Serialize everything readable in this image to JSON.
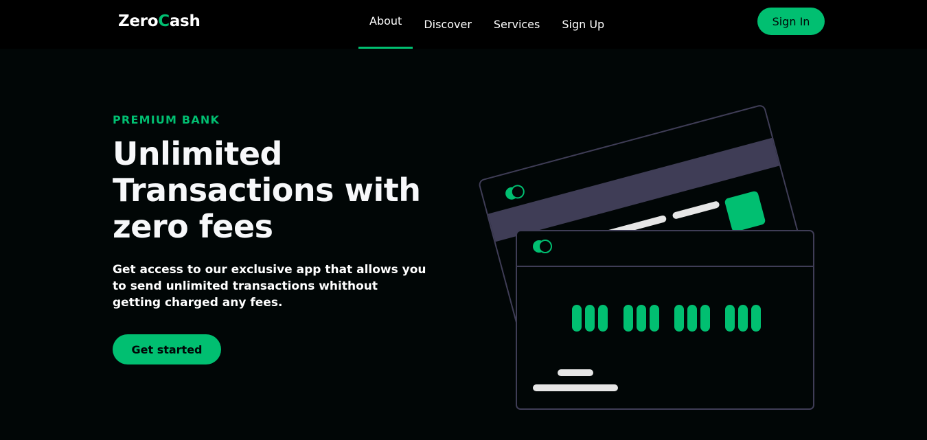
{
  "brand": {
    "logo_part1": "Zero",
    "logo_accent": "C",
    "logo_part2": "ash",
    "accent_color": "#01bf71"
  },
  "nav": {
    "items": [
      {
        "label": "About",
        "active": true
      },
      {
        "label": "Discover",
        "active": false
      },
      {
        "label": "Services",
        "active": false
      },
      {
        "label": "Sign Up",
        "active": false
      }
    ],
    "signin_label": "Sign In"
  },
  "hero": {
    "eyebrow": "Premium Bank",
    "headline": "Unlimited Transactions with zero fees",
    "subtitle": "Get access to our exclusive app that allows you to send unlimited transactions whithout getting charged any fees.",
    "cta_label": "Get started"
  },
  "illustration": {
    "icons": [
      "card-logo-icon",
      "chip-icon"
    ],
    "colors": {
      "accent": "#01bf71",
      "stripe": "#3f3d56",
      "card_outline": "#3f3d56",
      "bar": "#e6e6e6"
    }
  }
}
